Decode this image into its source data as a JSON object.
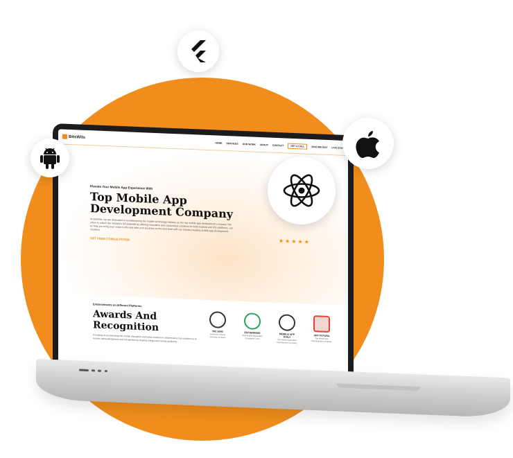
{
  "site": {
    "brand": "BitsWits",
    "nav": {
      "home": "HOME",
      "services": "SERVICES",
      "our_work": "OUR WORK",
      "about": "ABOUT",
      "contact": "CONTACT",
      "get_a_call": "GET A CALL",
      "phone": "(833) 888 0047",
      "live_chat": "LIVE CHAT"
    },
    "hero": {
      "eyebrow": "Elevate Your Mobile App Experience With",
      "title": "Top Mobile App Development Company",
      "description": "At BitsWits, we are dedicated to revolutionizing the mobile technology industry as the top mobile app development company. We strive to unlock the industry's full potential by offering innovative and customized solutions for both Android and iOS platforms. Let us help you bring your vision to life and take your business to the next level with our industry-leading mobile app development solutions.",
      "cta": "GET FREE CONSULTATION",
      "stars": "★★★★★"
    },
    "awards": {
      "eyebrow": "Endorsements on different Platforms",
      "title": "Awards And Recognition",
      "description": "Focusing on accelerating the mobile disruption and value creation in all directions has enabled us to receive acknowledgment and recognition by leading ratings and review platforms.",
      "items": [
        {
          "name": "INC.5000",
          "sub": "America's Fastest Growing Company"
        },
        {
          "name": "ENTERPRISE",
          "sub": "Best Mobile Application Companies 2022"
        },
        {
          "name": "MOBILE APP DAILY",
          "sub": "Top Mobile Application Development Company"
        },
        {
          "name": "APP FUTURA",
          "sub": "Top Mobile App Development Company"
        }
      ]
    }
  },
  "icons": [
    "flutter-icon",
    "apple-icon",
    "android-icon",
    "react-icon"
  ],
  "colors": {
    "accent": "#f08d1c",
    "laptop_bezel": "#1c1c1e",
    "laptop_base": "#cfcfcf"
  }
}
